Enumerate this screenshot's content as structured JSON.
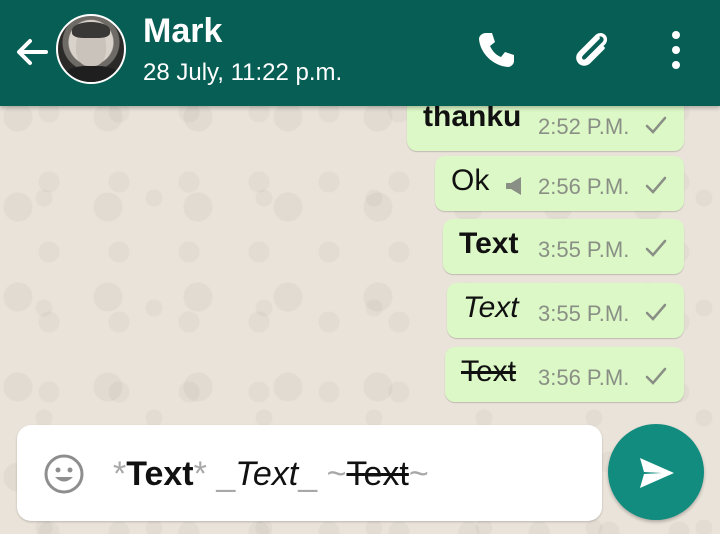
{
  "header": {
    "contact_name": "Mark",
    "last_seen": "28 July, 11:22 p.m."
  },
  "messages": [
    {
      "text": "thanku",
      "time": "2:52 P.M.",
      "style": "bold"
    },
    {
      "text": "Ok",
      "time": "2:56 P.M.",
      "style": "normal"
    },
    {
      "text": "Text",
      "time": "3:55 P.M.",
      "style": "bold"
    },
    {
      "text": "Text",
      "time": "3:55 P.M.",
      "style": "italic"
    },
    {
      "text": "Text",
      "time": "3:56 P.M.",
      "style": "strike"
    }
  ],
  "composer": {
    "bold_open": "*",
    "bold_text": "Text",
    "bold_close": "*",
    "italic_open": "_",
    "italic_text": "Text",
    "italic_close": "_",
    "strike_open": "~",
    "strike_text": "Text",
    "strike_close": "~"
  },
  "colors": {
    "header": "#075e54",
    "bubble": "#dcf8c6",
    "send_button": "#128c7e"
  },
  "icons": [
    "back-arrow-icon",
    "phone-icon",
    "paperclip-icon",
    "more-vert-icon",
    "megaphone-icon",
    "check-icon",
    "emoji-icon",
    "send-icon"
  ]
}
